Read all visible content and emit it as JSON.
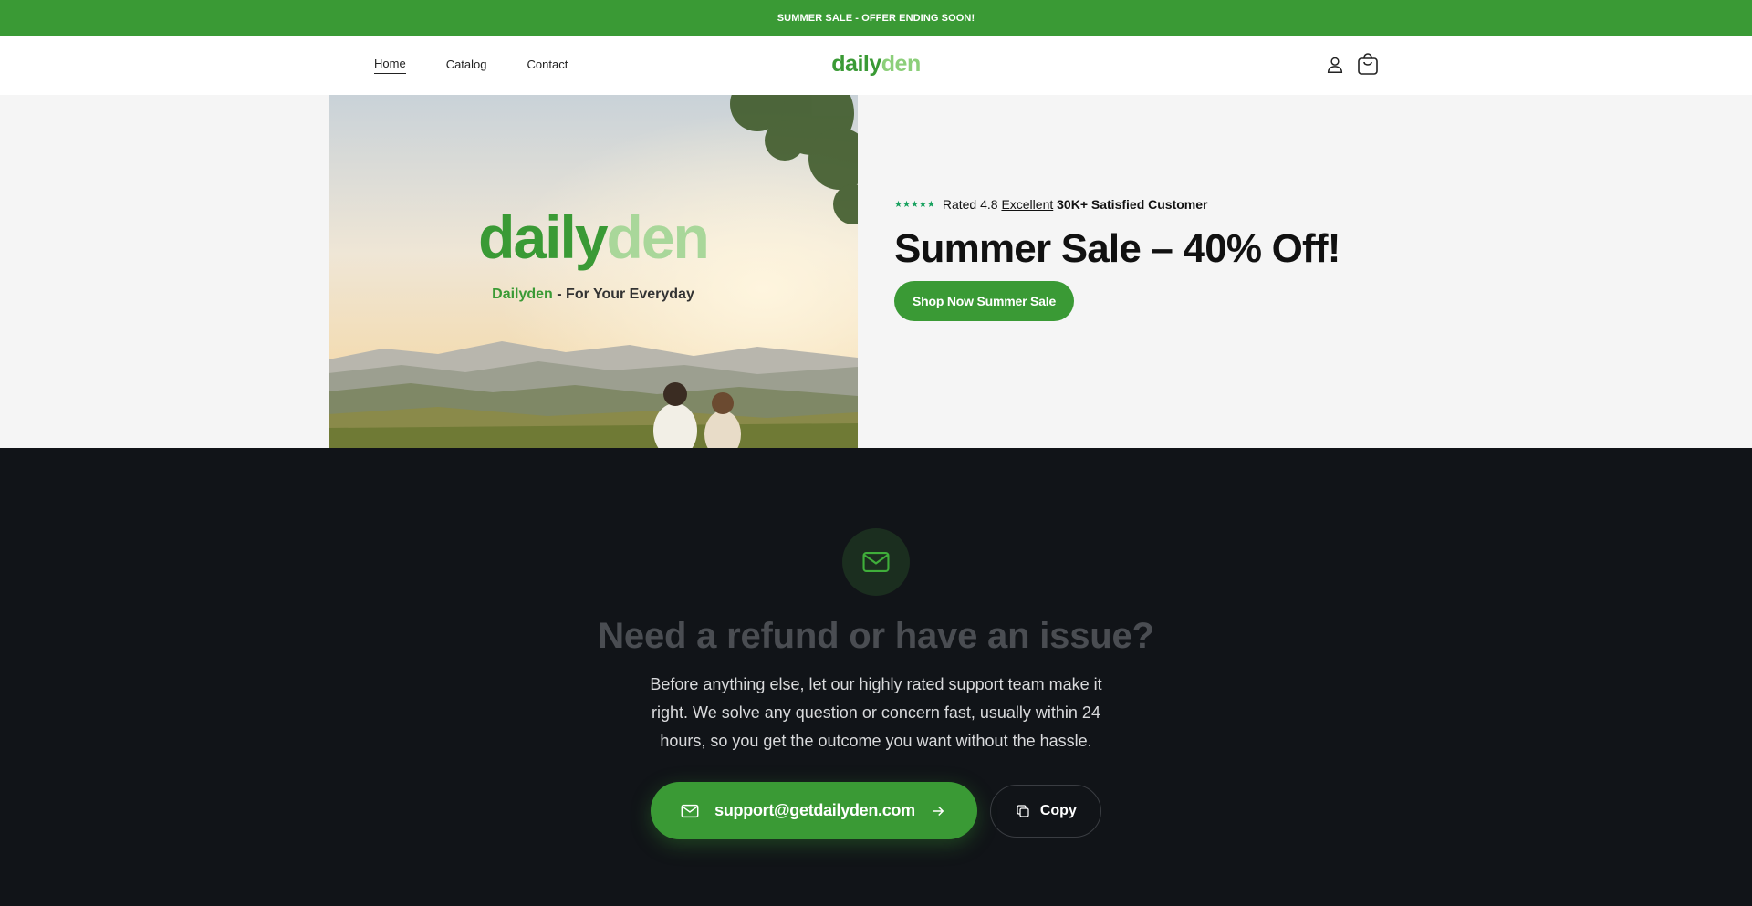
{
  "announcement": {
    "text": "SUMMER SALE - OFFER ENDING SOON!",
    "color": "#3a9a35"
  },
  "header": {
    "nav": [
      {
        "label": "Home",
        "active": true
      },
      {
        "label": "Catalog"
      },
      {
        "label": "Contact"
      }
    ],
    "logo": {
      "part1": "daily",
      "part2": "den"
    },
    "icons": [
      "account-icon",
      "cart-icon"
    ]
  },
  "hero": {
    "image_logo": {
      "part1": "daily",
      "part2": "den"
    },
    "image_tagline": {
      "brand": "Dailyden",
      "rest": " - For Your Everyday"
    },
    "stars": "★★★★★",
    "rating_text": "Rated 4.8",
    "rating_word": "Excellent",
    "customers": "30K+ Satisfied Customer",
    "title": "Summer Sale – 40% Off!",
    "cta": "Shop Now Summer Sale"
  },
  "support": {
    "icon": "mail-icon",
    "title": "Need a refund or have an issue?",
    "body": "Before anything else, let our highly rated support team make it right. We solve any question or concern fast, usually within 24 hours, so you get the outcome you want without the hassle.",
    "email": "support@getdailyden.com",
    "copy_label": "Copy"
  },
  "colors": {
    "brand_green": "#3a9a35",
    "dark_bg": "#111418",
    "star_green": "#1aa260"
  }
}
